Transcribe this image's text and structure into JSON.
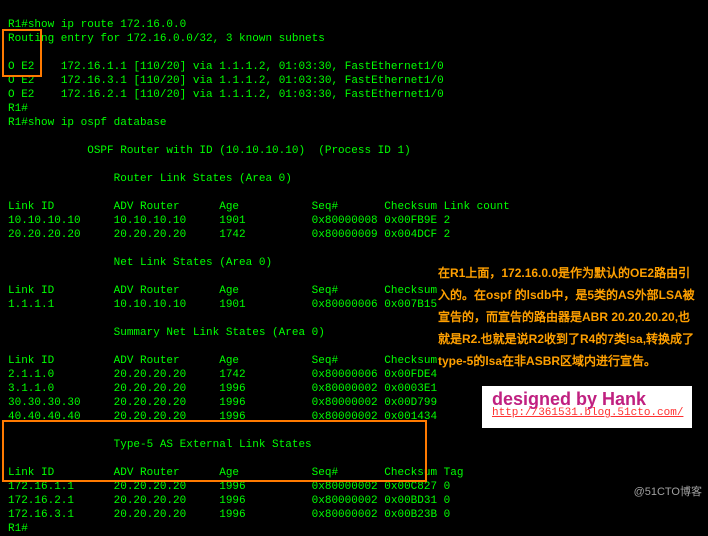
{
  "cmd1": {
    "prompt": "R1#",
    "command": "show ip route 172.16.0.0",
    "header": "Routing entry for 172.16.0.0/32, 3 known subnets",
    "blank": "",
    "routes": [
      {
        "code": "O E2",
        "net": "172.16.1.1",
        "metric": "[110/20]",
        "via": "via 1.1.1.2,",
        "time": "01:03:30,",
        "iface": "FastEthernet1/0"
      },
      {
        "code": "O E2",
        "net": "172.16.3.1",
        "metric": "[110/20]",
        "via": "via 1.1.1.2,",
        "time": "01:03:30,",
        "iface": "FastEthernet1/0"
      },
      {
        "code": "O E2",
        "net": "172.16.2.1",
        "metric": "[110/20]",
        "via": "via 1.1.1.2,",
        "time": "01:03:30,",
        "iface": "FastEthernet1/0"
      }
    ]
  },
  "prompt_idle": "R1#",
  "cmd2": {
    "prompt": "R1#",
    "command": "show ip ospf database",
    "title": "OSPF Router with ID (10.10.10.10)  (Process ID 1)",
    "router_ls": {
      "heading": "Router Link States (Area 0)",
      "cols": "Link ID         ADV Router      Age           Seq#       Checksum Link count",
      "rows": [
        "10.10.10.10     10.10.10.10     1901          0x80000008 0x00FB9E 2",
        "20.20.20.20     20.20.20.20     1742          0x80000009 0x004DCF 2"
      ]
    },
    "net_ls": {
      "heading": "Net Link States (Area 0)",
      "cols": "Link ID         ADV Router      Age           Seq#       Checksum",
      "rows": [
        "1.1.1.1         10.10.10.10     1901          0x80000006 0x007B15"
      ]
    },
    "sum_ls": {
      "heading": "Summary Net Link States (Area 0)",
      "cols": "Link ID         ADV Router      Age           Seq#       Checksum",
      "rows": [
        "2.1.1.0         20.20.20.20     1742          0x80000006 0x00FDE4",
        "3.1.1.0         20.20.20.20     1996          0x80000002 0x0003E1",
        "30.30.30.30     20.20.20.20     1996          0x80000002 0x00D799",
        "40.40.40.40     20.20.20.20     1996          0x80000002 0x001434"
      ]
    },
    "ext_ls": {
      "heading": "Type-5 AS External Link States",
      "cols": "Link ID         ADV Router      Age           Seq#       Checksum Tag",
      "rows": [
        "172.16.1.1      20.20.20.20     1996          0x80000002 0x00C827 0",
        "172.16.2.1      20.20.20.20     1996          0x80000002 0x00BD31 0",
        "172.16.3.1      20.20.20.20     1996          0x80000002 0x00B23B 0"
      ]
    }
  },
  "prompt_end": "R1#",
  "annotation": "在R1上面，172.16.0.0是作为默认的OE2路由引入的。在ospf 的lsdb中，是5类的AS外部LSA被宣告的，而宣告的路由器是ABR 20.20.20.20,也就是R2.也就是说R2收到了R4的7类lsa,转换成了type-5的lsa在非ASBR区域内进行宣告。",
  "credit": {
    "title": "designed by Hank",
    "url": "http://361531.blog.51cto.com/"
  },
  "watermark": "@51CTO博客"
}
